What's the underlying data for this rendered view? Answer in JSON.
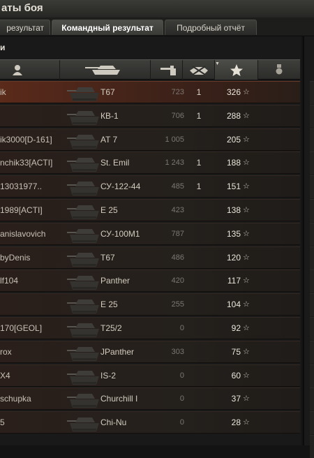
{
  "window": {
    "title": "аты боя"
  },
  "tabs": [
    {
      "label": "результат",
      "active": false
    },
    {
      "label": "Командный результат",
      "active": true
    },
    {
      "label": "Подробный отчёт",
      "active": false
    }
  ],
  "team": {
    "header": "и"
  },
  "columns": {
    "player_icon": "player-icon",
    "vehicle_icon": "tank-icon",
    "damage_icon": "damage-gun-icon",
    "kills_icon": "destroyed-tank-icon",
    "xp_icon": "star-icon",
    "medal_icon": "medal-icon",
    "sort_indicator": "sort-down-icon"
  },
  "rows": [
    {
      "player": "ik",
      "tank": "T67",
      "damage": "723",
      "kills": "1",
      "xp": "326",
      "self": true
    },
    {
      "player": "",
      "tank": "КВ-1",
      "damage": "706",
      "kills": "1",
      "xp": "288"
    },
    {
      "player": "ik3000[D-161]",
      "tank": "AT 7",
      "damage": "1 005",
      "kills": "",
      "xp": "205"
    },
    {
      "player": "nchik33[ACTI]",
      "tank": "St. Emil",
      "damage": "1 243",
      "kills": "1",
      "xp": "188"
    },
    {
      "player": "13031977..",
      "tank": "СУ-122-44",
      "damage": "485",
      "kills": "1",
      "xp": "151"
    },
    {
      "player": "1989[ACTI]",
      "tank": "E 25",
      "damage": "423",
      "kills": "",
      "xp": "138"
    },
    {
      "player": "anislavovich",
      "tank": "СУ-100М1",
      "damage": "787",
      "kills": "",
      "xp": "135"
    },
    {
      "player": "byDenis",
      "tank": "T67",
      "damage": "486",
      "kills": "",
      "xp": "120"
    },
    {
      "player": "lf104",
      "tank": "Panther",
      "damage": "420",
      "kills": "",
      "xp": "117"
    },
    {
      "player": "",
      "tank": "E 25",
      "damage": "255",
      "kills": "",
      "xp": "104"
    },
    {
      "player": "170[GEOL]",
      "tank": "T25/2",
      "damage": "0",
      "kills": "",
      "xp": "92"
    },
    {
      "player": "rox",
      "tank": "JPanther",
      "damage": "303",
      "kills": "",
      "xp": "75"
    },
    {
      "player": "X4",
      "tank": "IS-2",
      "damage": "0",
      "kills": "",
      "xp": "60"
    },
    {
      "player": "schupka",
      "tank": "Churchill I",
      "damage": "0",
      "kills": "",
      "xp": "37"
    },
    {
      "player": "5",
      "tank": "Chi-Nu",
      "damage": "0",
      "kills": "",
      "xp": "28"
    }
  ]
}
